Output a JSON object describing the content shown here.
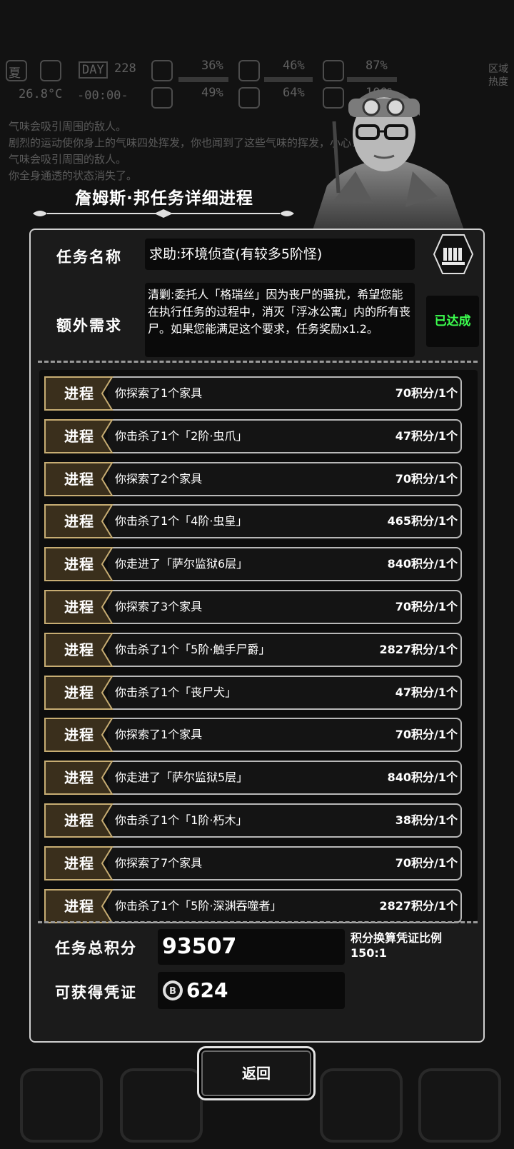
{
  "hud": {
    "season": "夏",
    "day": "DAY",
    "day_num": "228",
    "temperature": "26.8°C",
    "clock": "-00:00-",
    "stats": [
      "36%",
      "46%",
      "87%",
      "49%",
      "64%",
      "100%"
    ],
    "region_label": "区域热度"
  },
  "log_lines": [
    "气味会吸引周围的敌人。",
    "剧烈的运动使你身上的气味四处挥发，你也闻到了这些气味的挥发，小心！这些",
    "气味会吸引周围的敌人。",
    "你全身通透的状态消失了。"
  ],
  "header": {
    "title": "詹姆斯·邦任务详细进程"
  },
  "task": {
    "name_label": "任务名称",
    "name": "求助:环境侦查(有较多5阶怪)",
    "extra_label": "额外需求",
    "extra_text": "清剿:委托人「格瑞丝」因为丧尸的骚扰，希望您能在执行任务的过程中，消灭「浮冰公寓」内的所有丧尸。如果您能满足这个要求，任务奖励x1.2。",
    "extra_status": "已达成"
  },
  "progress": [
    {
      "tag": "进程",
      "desc": "你探索了1个家具",
      "score": "70积分/1个"
    },
    {
      "tag": "进程",
      "desc": "你击杀了1个「2阶·虫爪」",
      "score": "47积分/1个"
    },
    {
      "tag": "进程",
      "desc": "你探索了2个家具",
      "score": "70积分/1个"
    },
    {
      "tag": "进程",
      "desc": "你击杀了1个「4阶·虫皇」",
      "score": "465积分/1个"
    },
    {
      "tag": "进程",
      "desc": "你走进了「萨尔监狱6层」",
      "score": "840积分/1个"
    },
    {
      "tag": "进程",
      "desc": "你探索了3个家具",
      "score": "70积分/1个"
    },
    {
      "tag": "进程",
      "desc": "你击杀了1个「5阶·触手尸爵」",
      "score": "2827积分/1个"
    },
    {
      "tag": "进程",
      "desc": "你击杀了1个「丧尸犬」",
      "score": "47积分/1个"
    },
    {
      "tag": "进程",
      "desc": "你探索了1个家具",
      "score": "70积分/1个"
    },
    {
      "tag": "进程",
      "desc": "你走进了「萨尔监狱5层」",
      "score": "840积分/1个"
    },
    {
      "tag": "进程",
      "desc": "你击杀了1个「1阶·朽木」",
      "score": "38积分/1个"
    },
    {
      "tag": "进程",
      "desc": "你探索了7个家具",
      "score": "70积分/1个"
    },
    {
      "tag": "进程",
      "desc": "你击杀了1个「5阶·深渊吞噬者」",
      "score": "2827积分/1个"
    }
  ],
  "summary": {
    "total_label": "任务总积分",
    "total_value": "93507",
    "ratio_label": "积分换算凭证比例",
    "ratio_value": "150:1",
    "voucher_label": "可获得凭证",
    "voucher_value": "624"
  },
  "back_label": "返回",
  "colors": {
    "accent_done": "#3cff4f",
    "tag_brown": "#3a2f1c",
    "tag_border": "#c7ad73"
  }
}
